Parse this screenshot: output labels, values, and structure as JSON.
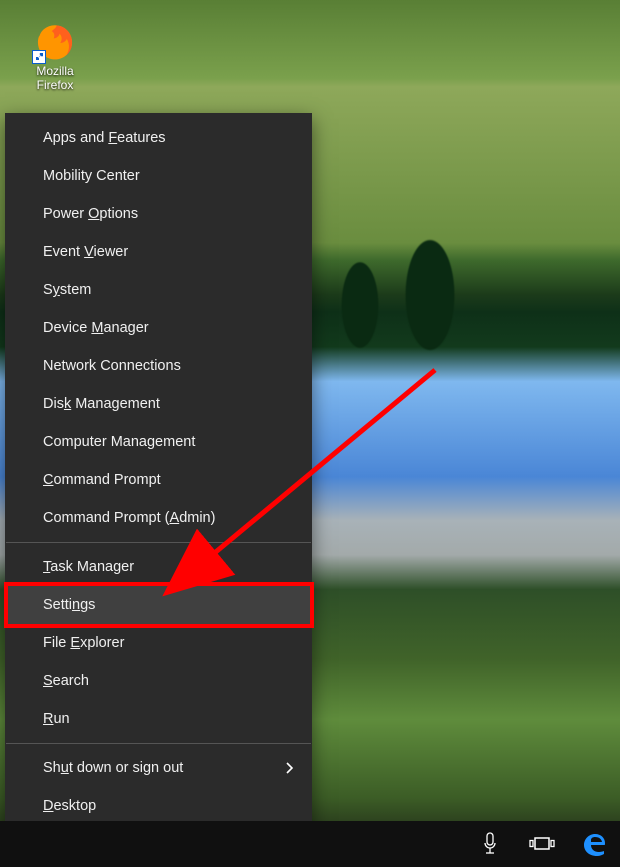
{
  "desktop": {
    "icon_label_line1": "Mozilla",
    "icon_label_line2": "Firefox"
  },
  "menu": {
    "groups": [
      [
        {
          "pre": "Apps and ",
          "ak": "F",
          "post": "eatures"
        },
        {
          "pre": "Mobility Center",
          "ak": "",
          "post": ""
        },
        {
          "pre": "Power ",
          "ak": "O",
          "post": "ptions"
        },
        {
          "pre": "Event ",
          "ak": "V",
          "post": "iewer"
        },
        {
          "pre": "S",
          "ak": "y",
          "post": "stem"
        },
        {
          "pre": "Device ",
          "ak": "M",
          "post": "anager"
        },
        {
          "pre": "Network Connections",
          "ak": "",
          "post": ""
        },
        {
          "pre": "Dis",
          "ak": "k",
          "post": " Management"
        },
        {
          "pre": "Computer Mana",
          "ak": "g",
          "post": "ement"
        },
        {
          "pre": "",
          "ak": "C",
          "post": "ommand Prompt"
        },
        {
          "pre": "Command Prompt (",
          "ak": "A",
          "post": "dmin)"
        }
      ],
      [
        {
          "pre": "",
          "ak": "T",
          "post": "ask Manager"
        },
        {
          "pre": "Setti",
          "ak": "n",
          "post": "gs",
          "hover": true,
          "highlight": true
        },
        {
          "pre": "File ",
          "ak": "E",
          "post": "xplorer"
        },
        {
          "pre": "",
          "ak": "S",
          "post": "earch"
        },
        {
          "pre": "",
          "ak": "R",
          "post": "un"
        }
      ],
      [
        {
          "pre": "Sh",
          "ak": "u",
          "post": "t down or sign out",
          "submenu": true
        },
        {
          "pre": "",
          "ak": "D",
          "post": "esktop"
        }
      ]
    ]
  },
  "taskbar": {
    "cortana_tip": "Cortana",
    "taskview_tip": "Task View",
    "edge_tip": "Microsoft Edge"
  }
}
